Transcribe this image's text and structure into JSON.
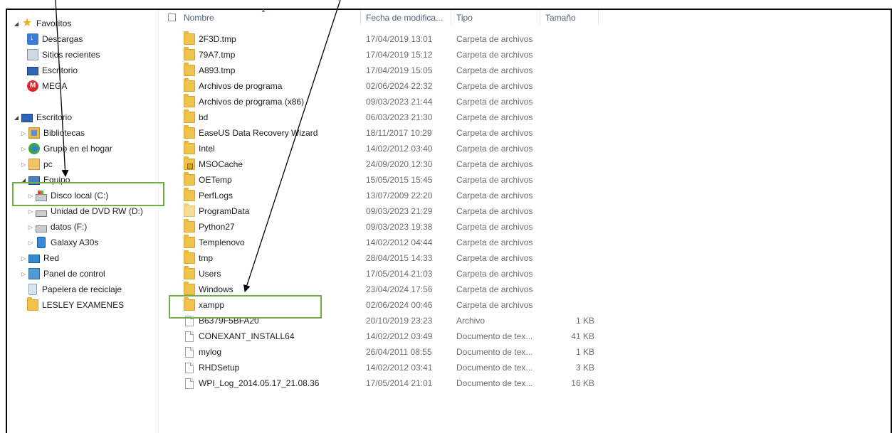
{
  "sidebar": {
    "items": [
      {
        "label": "Favoritos",
        "icon": "star-icon",
        "expand": "open"
      },
      {
        "label": "Descargas",
        "icon": "downloads-icon"
      },
      {
        "label": "Sitios recientes",
        "icon": "recent-places-icon"
      },
      {
        "label": "Escritorio",
        "icon": "desktop-icon"
      },
      {
        "label": "MEGA",
        "icon": "mega-icon"
      },
      {
        "label": "Escritorio",
        "icon": "desktop-icon",
        "expand": "open"
      },
      {
        "label": "Bibliotecas",
        "icon": "libraries-icon",
        "expand": "closed"
      },
      {
        "label": "Grupo en el hogar",
        "icon": "homegroup-icon",
        "expand": "closed"
      },
      {
        "label": "pc",
        "icon": "user-folder-icon",
        "expand": "closed"
      },
      {
        "label": "Equipo",
        "icon": "computer-icon",
        "expand": "open"
      },
      {
        "label": "Disco local (C:)",
        "icon": "local-disk-icon",
        "expand": "closed",
        "selected": true
      },
      {
        "label": "Unidad de DVD RW (D:)",
        "icon": "dvd-drive-icon",
        "expand": "closed"
      },
      {
        "label": "datos (F:)",
        "icon": "drive-icon",
        "expand": "closed"
      },
      {
        "label": "Galaxy A30s",
        "icon": "phone-icon",
        "expand": "closed"
      },
      {
        "label": "Red",
        "icon": "network-icon",
        "expand": "closed"
      },
      {
        "label": "Panel de control",
        "icon": "control-panel-icon",
        "expand": "closed"
      },
      {
        "label": "Papelera de reciclaje",
        "icon": "recycle-bin-icon"
      },
      {
        "label": "LESLEY EXAMENES",
        "icon": "folder-icon"
      }
    ]
  },
  "columns": {
    "name": "Nombre",
    "date": "Fecha de modifica...",
    "type": "Tipo",
    "size": "Tamaño"
  },
  "files": [
    {
      "name": "2F3D.tmp",
      "date": "17/04/2019 13:01",
      "type": "Carpeta de archivos",
      "size": "",
      "icon": "folder-icon"
    },
    {
      "name": "79A7.tmp",
      "date": "17/04/2019 15:12",
      "type": "Carpeta de archivos",
      "size": "",
      "icon": "folder-icon"
    },
    {
      "name": "A893.tmp",
      "date": "17/04/2019 15:05",
      "type": "Carpeta de archivos",
      "size": "",
      "icon": "folder-icon"
    },
    {
      "name": "Archivos de programa",
      "date": "02/06/2024 22:32",
      "type": "Carpeta de archivos",
      "size": "",
      "icon": "folder-icon"
    },
    {
      "name": "Archivos de programa (x86)",
      "date": "09/03/2023 21:44",
      "type": "Carpeta de archivos",
      "size": "",
      "icon": "folder-icon"
    },
    {
      "name": "bd",
      "date": "06/03/2023 21:30",
      "type": "Carpeta de archivos",
      "size": "",
      "icon": "folder-icon"
    },
    {
      "name": "EaseUS Data Recovery Wizard",
      "date": "18/11/2017 10:29",
      "type": "Carpeta de archivos",
      "size": "",
      "icon": "folder-icon"
    },
    {
      "name": "Intel",
      "date": "14/02/2012 03:40",
      "type": "Carpeta de archivos",
      "size": "",
      "icon": "folder-icon"
    },
    {
      "name": "MSOCache",
      "date": "24/09/2020 12:30",
      "type": "Carpeta de archivos",
      "size": "",
      "icon": "locked-folder-icon"
    },
    {
      "name": "OETemp",
      "date": "15/05/2015 15:45",
      "type": "Carpeta de archivos",
      "size": "",
      "icon": "folder-icon"
    },
    {
      "name": "PerfLogs",
      "date": "13/07/2009 22:20",
      "type": "Carpeta de archivos",
      "size": "",
      "icon": "folder-icon"
    },
    {
      "name": "ProgramData",
      "date": "09/03/2023 21:29",
      "type": "Carpeta de archivos",
      "size": "",
      "icon": "hidden-folder-icon"
    },
    {
      "name": "Python27",
      "date": "09/03/2023 19:38",
      "type": "Carpeta de archivos",
      "size": "",
      "icon": "folder-icon"
    },
    {
      "name": "Templenovo",
      "date": "14/02/2012 04:44",
      "type": "Carpeta de archivos",
      "size": "",
      "icon": "folder-icon"
    },
    {
      "name": "tmp",
      "date": "28/04/2015 14:33",
      "type": "Carpeta de archivos",
      "size": "",
      "icon": "folder-icon"
    },
    {
      "name": "Users",
      "date": "17/05/2014 21:03",
      "type": "Carpeta de archivos",
      "size": "",
      "icon": "folder-icon"
    },
    {
      "name": "Windows",
      "date": "23/04/2024 17:56",
      "type": "Carpeta de archivos",
      "size": "",
      "icon": "folder-icon"
    },
    {
      "name": "xampp",
      "date": "02/06/2024 00:46",
      "type": "Carpeta de archivos",
      "size": "",
      "icon": "folder-icon",
      "highlighted": true
    },
    {
      "name": "B6379F5BFA20",
      "date": "20/10/2019 23:23",
      "type": "Archivo",
      "size": "1 KB",
      "icon": "file-icon"
    },
    {
      "name": "CONEXANT_INSTALL64",
      "date": "14/02/2012 03:49",
      "type": "Documento de tex...",
      "size": "41 KB",
      "icon": "text-file-icon"
    },
    {
      "name": "mylog",
      "date": "26/04/2011 08:55",
      "type": "Documento de tex...",
      "size": "1 KB",
      "icon": "text-file-icon"
    },
    {
      "name": "RHDSetup",
      "date": "14/02/2012 03:41",
      "type": "Documento de tex...",
      "size": "3 KB",
      "icon": "text-file-icon"
    },
    {
      "name": "WPI_Log_2014.05.17_21.08.36",
      "date": "17/05/2014 21:01",
      "type": "Documento de tex...",
      "size": "16 KB",
      "icon": "text-file-icon"
    }
  ],
  "annotations": {
    "highlight_color": "#70ad47",
    "arrow_color": "#000000"
  }
}
